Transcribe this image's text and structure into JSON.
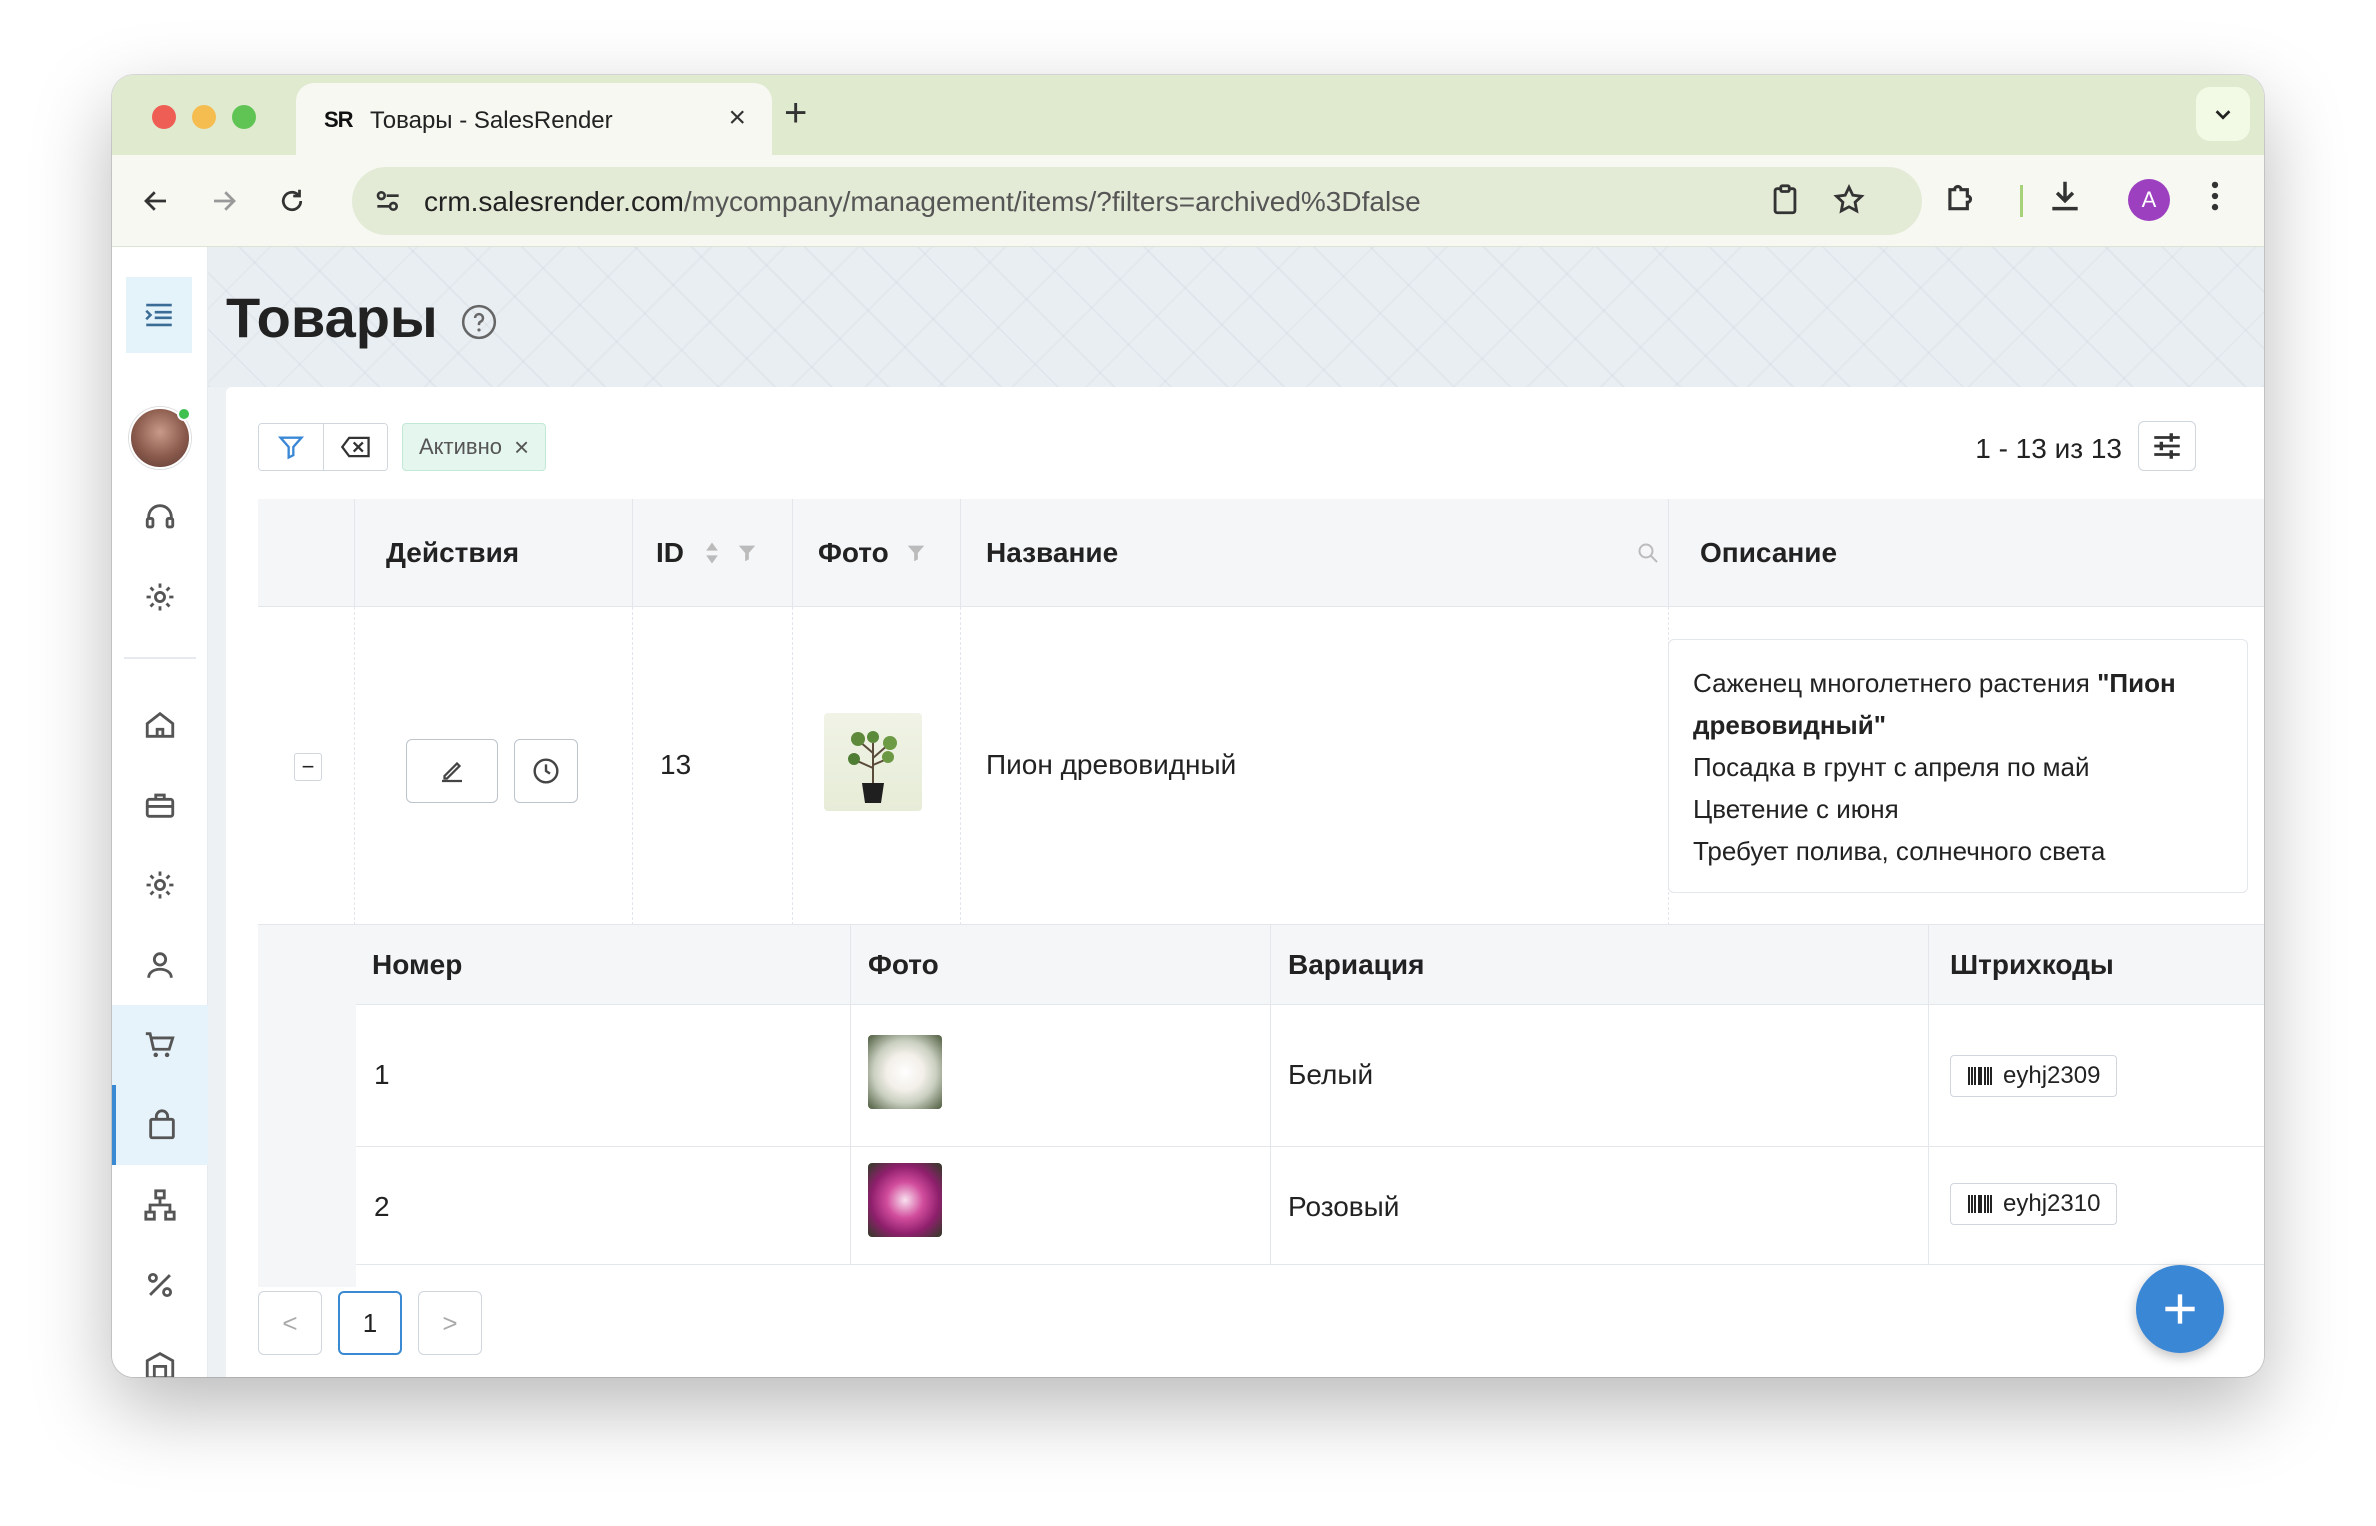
{
  "browser": {
    "tab_title": "Товары - SalesRender",
    "favicon_text": "SR",
    "url_host": "crm.salesrender.com",
    "url_path": "/mycompany/management/items/?filters=archived%3Dfalse",
    "profile_initial": "A"
  },
  "page": {
    "title": "Товары"
  },
  "filters": {
    "active_chip": "Активно",
    "pager_info": "1 - 13 из 13"
  },
  "table": {
    "columns": [
      "Действия",
      "ID",
      "Фото",
      "Название",
      "Описание"
    ],
    "row": {
      "id": "13",
      "name": "Пион древовидный",
      "description": {
        "line1_prefix": "Саженец многолетнего растения ",
        "line1_bold": "\"Пион древовидный\"",
        "line2": "Посадка в грунт с апреля по май",
        "line3": "Цветение с июня",
        "line4": "Требует полива, солнечного света"
      }
    }
  },
  "subtable": {
    "columns": [
      "Номер",
      "Фото",
      "Вариация",
      "Штрихкоды"
    ],
    "rows": [
      {
        "number": "1",
        "variation": "Белый",
        "barcode": "eyhj2309"
      },
      {
        "number": "2",
        "variation": "Розовый",
        "barcode": "eyhj2310"
      }
    ]
  },
  "pagination": {
    "current": "1",
    "prev": "<",
    "next": ">"
  },
  "colors": {
    "accent": "#3a87d6",
    "chip_bg": "#e5f6ee",
    "online": "#3fc04f"
  }
}
